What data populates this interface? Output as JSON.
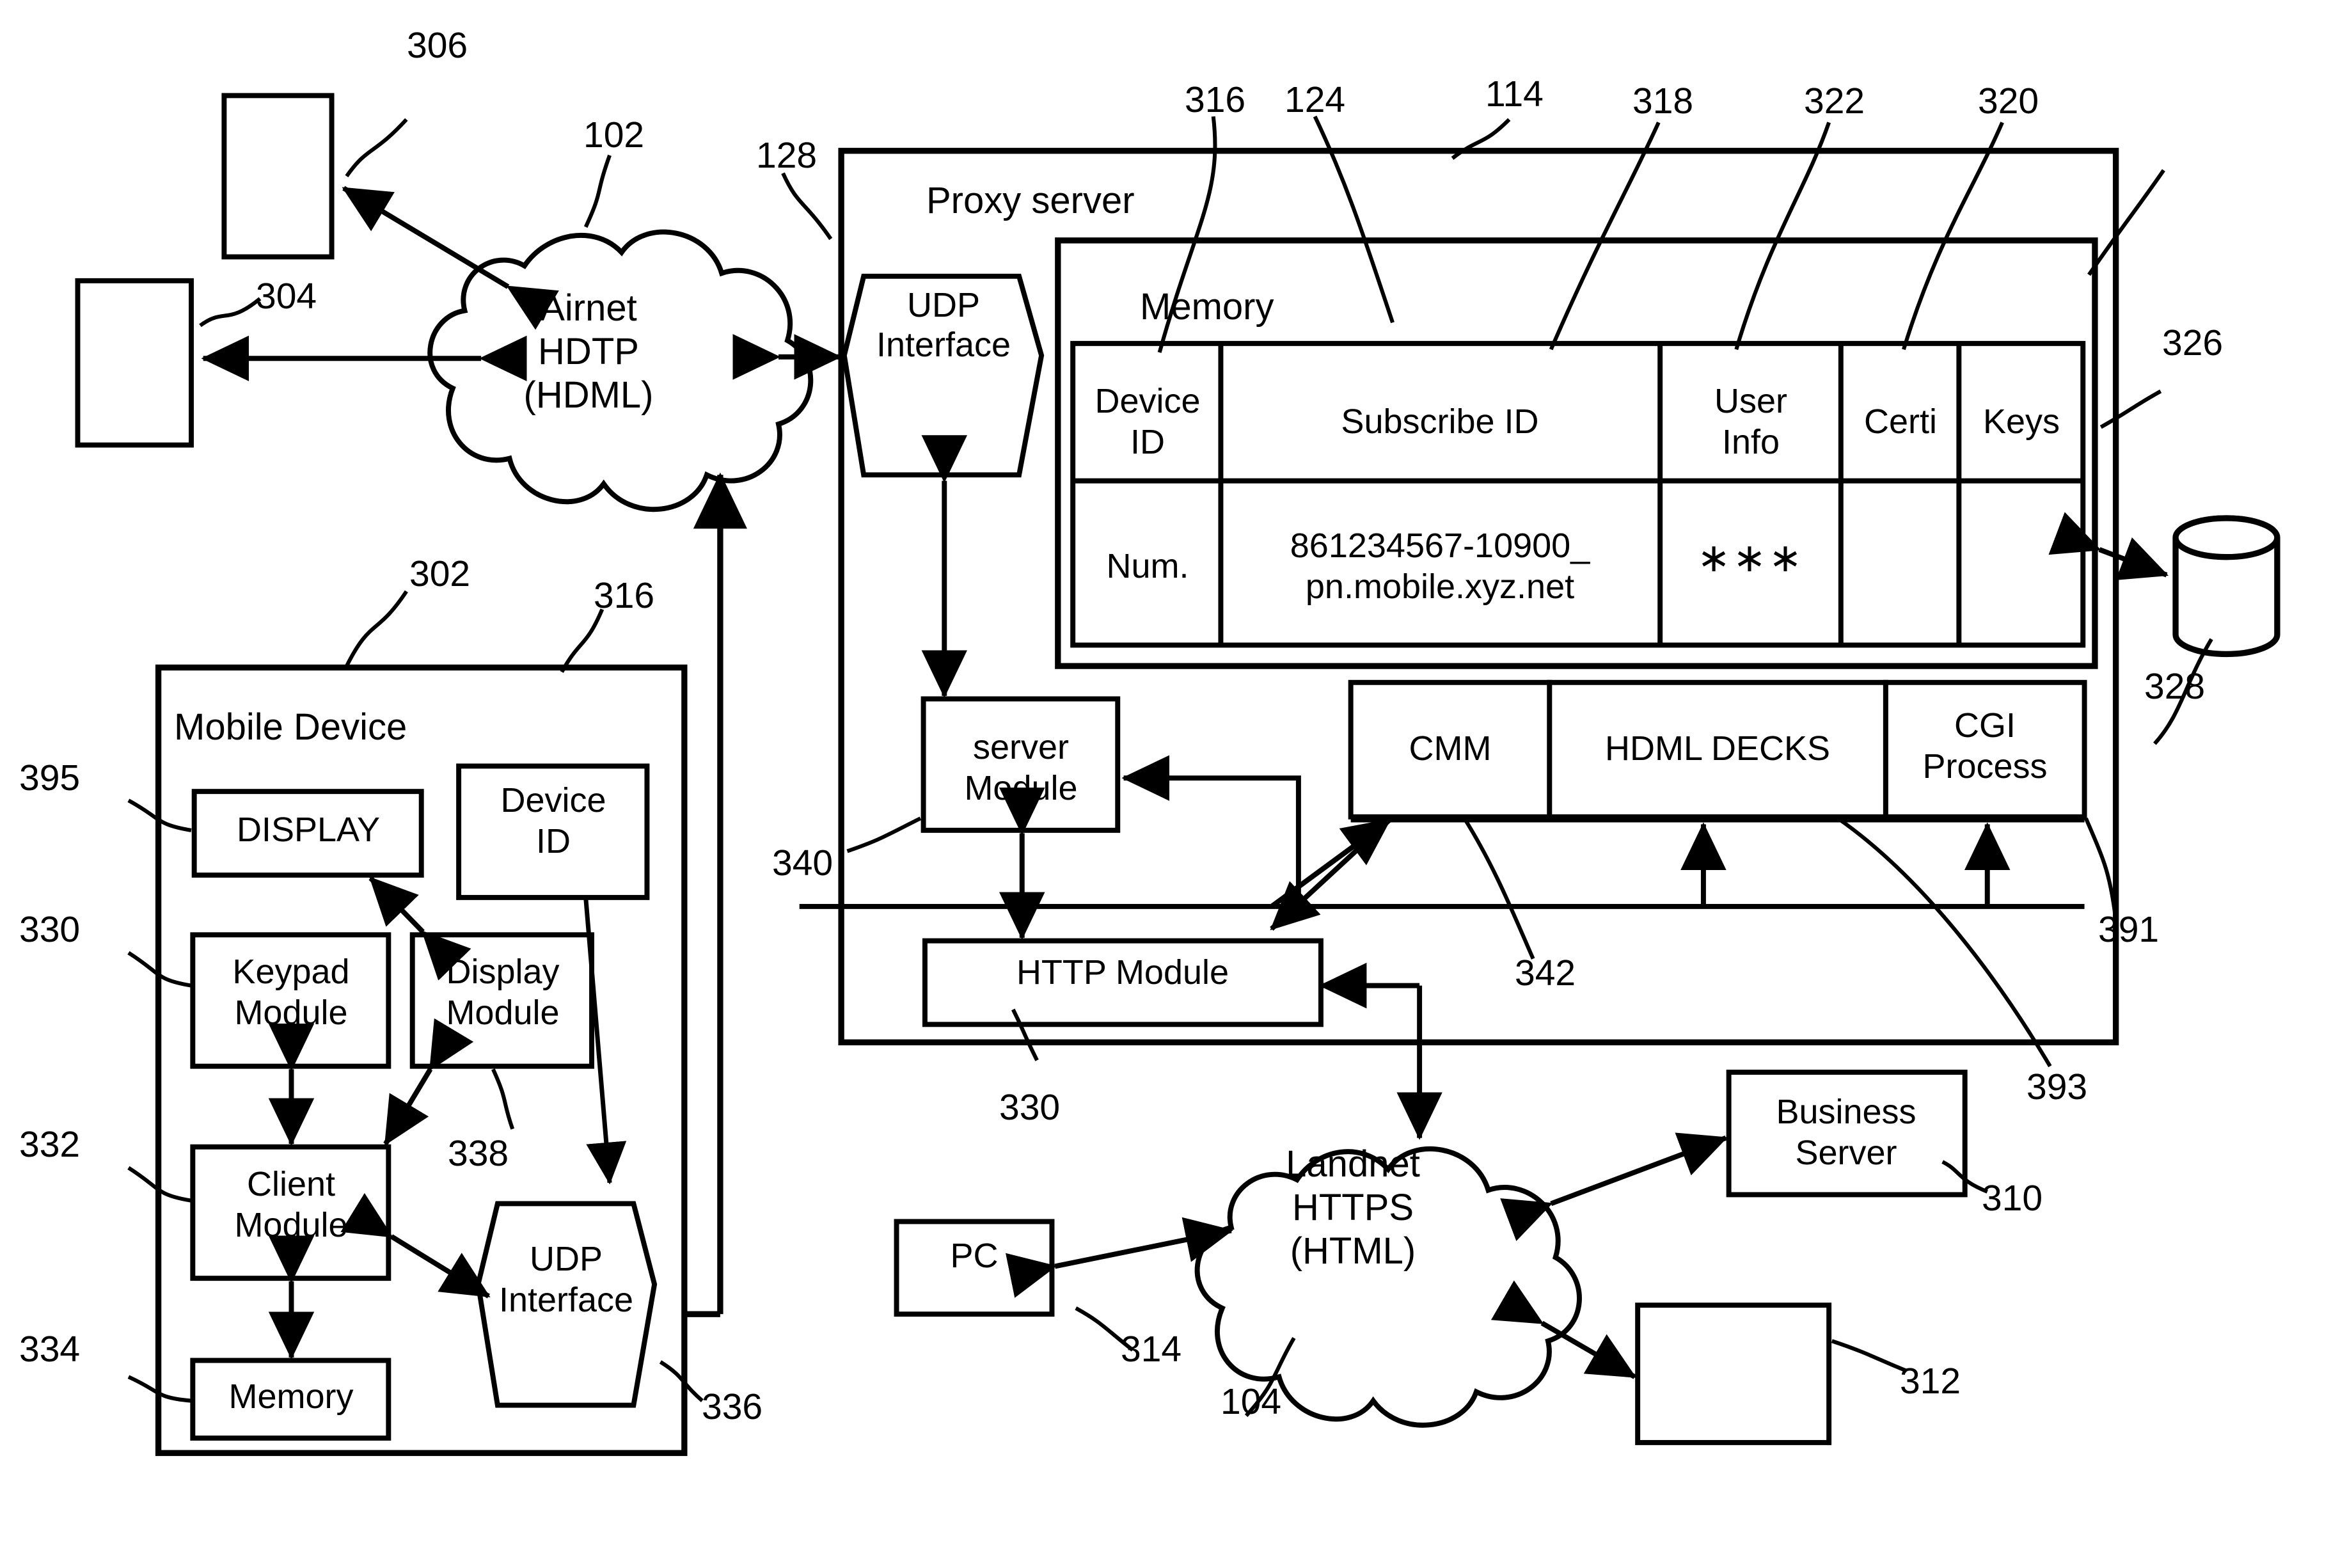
{
  "figure": {
    "kind": "patent-block-diagram",
    "background": "#ffffff",
    "stroke": "#000000"
  },
  "networks": {
    "airnet": {
      "line1": "Airnet",
      "line2": "HDTP",
      "line3": "(HDML)",
      "ref": "102"
    },
    "landnet": {
      "line1": "Landnet",
      "line2": "HTTPS",
      "line3": "(HTML)",
      "ref": "104"
    }
  },
  "terminals": {
    "device_306_ref": "306",
    "device_304_ref": "304",
    "pc": {
      "label": "PC",
      "ref": "314"
    },
    "business_server": {
      "line1": "Business",
      "line2": "Server",
      "ref": "310"
    },
    "device_312_ref": "312"
  },
  "mobile_device": {
    "title": "Mobile Device",
    "ref": "302",
    "device_id": {
      "line1": "Device",
      "line2": "ID",
      "ref": "316"
    },
    "display": {
      "label": "DISPLAY",
      "ref": "395"
    },
    "keypad_module": {
      "line1": "Keypad",
      "line2": "Module",
      "ref": "330"
    },
    "display_module": {
      "line1": "Display",
      "line2": "Module",
      "ref": "338"
    },
    "client_module": {
      "line1": "Client",
      "line2": "Module",
      "ref": "332"
    },
    "memory": {
      "label": "Memory",
      "ref": "334"
    },
    "udp_interface": {
      "line1": "UDP",
      "line2": "Interface",
      "ref": "336"
    }
  },
  "proxy_server": {
    "title": "Proxy server",
    "ref": "114",
    "udp_interface": {
      "line1": "UDP",
      "line2": "Interface",
      "ref": "128"
    },
    "memory": {
      "title": "Memory",
      "ref": "124"
    },
    "server_module": {
      "line1": "server",
      "line2": "Module",
      "ref": "340"
    },
    "http_module": {
      "label": "HTTP Module",
      "ref": "330"
    },
    "cmm": {
      "label": "CMM",
      "ref": "342"
    },
    "hdml_decks": {
      "label": "HDML DECKS",
      "ref": "393"
    },
    "cgi_process": {
      "line1": "CGI",
      "line2": "Process",
      "ref": "391"
    },
    "database": {
      "ref": "328"
    },
    "keys_column_ref": "326"
  },
  "memory_table": {
    "headers": [
      {
        "text_line1": "Device",
        "text_line2": "ID",
        "ref": "316"
      },
      {
        "text_line1": "Subscribe ID",
        "text_line2": "",
        "ref": "318"
      },
      {
        "text_line1": "User",
        "text_line2": "Info",
        "ref": "322"
      },
      {
        "text_line1": "Certi",
        "text_line2": "",
        "ref": "320"
      },
      {
        "text_line1": "Keys",
        "text_line2": "",
        "ref": "326"
      }
    ],
    "rows": [
      {
        "device_id": "Num.",
        "subscribe_id_line1": "861234567-10900_",
        "subscribe_id_line2": "pn.mobile.xyz.net",
        "user_info": "∗∗∗",
        "certi": "",
        "keys": ""
      }
    ]
  },
  "reference_numerals": [
    "102",
    "104",
    "114",
    "124",
    "128",
    "302",
    "304",
    "306",
    "310",
    "312",
    "314",
    "316",
    "318",
    "320",
    "322",
    "326",
    "328",
    "330",
    "332",
    "334",
    "336",
    "338",
    "340",
    "342",
    "391",
    "393",
    "395"
  ]
}
